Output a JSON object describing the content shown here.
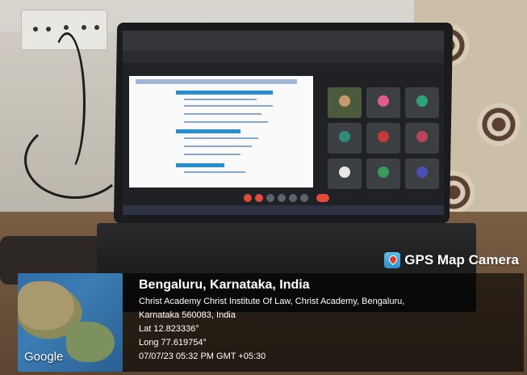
{
  "watermark": {
    "brand_icon": "map-pin-camera-icon",
    "brand_name": "GPS Map Camera"
  },
  "location": {
    "city": "Bengaluru, Karnataka, India",
    "address_line1": "Christ Academy Christ Institute Of Law, Christ Academy, Bengaluru,",
    "address_line2": "Karnataka 560083, India",
    "lat": "Lat 12.823336°",
    "long": "Long 77.619754°",
    "datetime": "07/07/23 05:32 PM GMT +05:30"
  },
  "map": {
    "provider": "Google"
  },
  "colors": {
    "overlay": "#000000",
    "text": "#ffffff"
  }
}
